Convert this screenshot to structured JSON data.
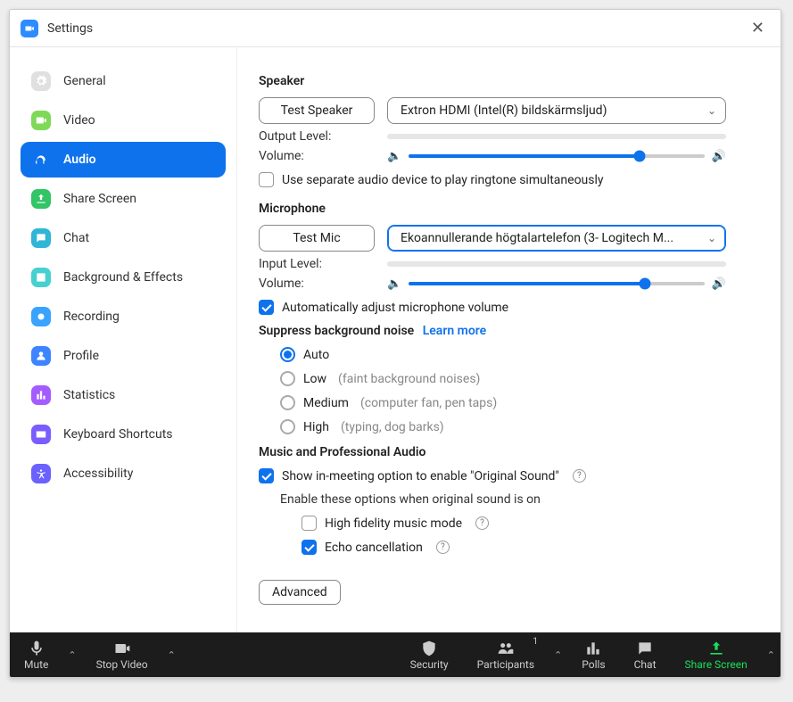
{
  "window": {
    "title": "Settings"
  },
  "sidebar": {
    "items": [
      {
        "label": "General",
        "icon": "gear",
        "bg": "#e0e0e0",
        "fg": "#fff"
      },
      {
        "label": "Video",
        "icon": "video",
        "bg": "#7ed957",
        "fg": "#fff"
      },
      {
        "label": "Audio",
        "icon": "headphones",
        "bg": "#0E72ED",
        "fg": "#fff",
        "active": true
      },
      {
        "label": "Share Screen",
        "icon": "share",
        "bg": "#32c466",
        "fg": "#fff"
      },
      {
        "label": "Chat",
        "icon": "chat",
        "bg": "#2fb6d6",
        "fg": "#fff"
      },
      {
        "label": "Background & Effects",
        "icon": "bgfx",
        "bg": "#46d0d0",
        "fg": "#fff"
      },
      {
        "label": "Recording",
        "icon": "record",
        "bg": "#3aa3ff",
        "fg": "#fff"
      },
      {
        "label": "Profile",
        "icon": "profile",
        "bg": "#3d84ff",
        "fg": "#fff"
      },
      {
        "label": "Statistics",
        "icon": "stats",
        "bg": "#a45bff",
        "fg": "#fff"
      },
      {
        "label": "Keyboard Shortcuts",
        "icon": "keyboard",
        "bg": "#7a5cff",
        "fg": "#fff"
      },
      {
        "label": "Accessibility",
        "icon": "accessibility",
        "bg": "#6b61ff",
        "fg": "#fff"
      }
    ]
  },
  "audio": {
    "speaker": {
      "heading": "Speaker",
      "test_button": "Test Speaker",
      "device": "Extron HDMI (Intel(R) bildskärmsljud)",
      "output_level_label": "Output Level:",
      "volume_label": "Volume:",
      "volume_pct": 78,
      "ringtone_separate": "Use separate audio device to play ringtone simultaneously"
    },
    "microphone": {
      "heading": "Microphone",
      "test_button": "Test Mic",
      "device": "Ekoannullerande högtalartelefon (3- Logitech M...",
      "input_level_label": "Input Level:",
      "volume_label": "Volume:",
      "volume_pct": 80,
      "auto_adjust": "Automatically adjust microphone volume"
    },
    "suppress": {
      "heading": "Suppress background noise",
      "learn_more": "Learn more",
      "options": [
        {
          "label": "Auto",
          "hint": ""
        },
        {
          "label": "Low",
          "hint": "(faint background noises)"
        },
        {
          "label": "Medium",
          "hint": "(computer fan, pen taps)"
        },
        {
          "label": "High",
          "hint": "(typing, dog barks)"
        }
      ],
      "selected": 0
    },
    "music": {
      "heading": "Music and Professional Audio",
      "show_original": "Show in-meeting option to enable \"Original Sound\"",
      "enable_when_on": "Enable these options when original sound is on",
      "high_fidelity": "High fidelity music mode",
      "echo_cancel": "Echo cancellation"
    },
    "advanced": "Advanced"
  },
  "meetingbar": {
    "mute": "Mute",
    "stop_video": "Stop Video",
    "security": "Security",
    "participants": "Participants",
    "participants_count": "1",
    "polls": "Polls",
    "chat": "Chat",
    "share_screen": "Share Screen"
  }
}
